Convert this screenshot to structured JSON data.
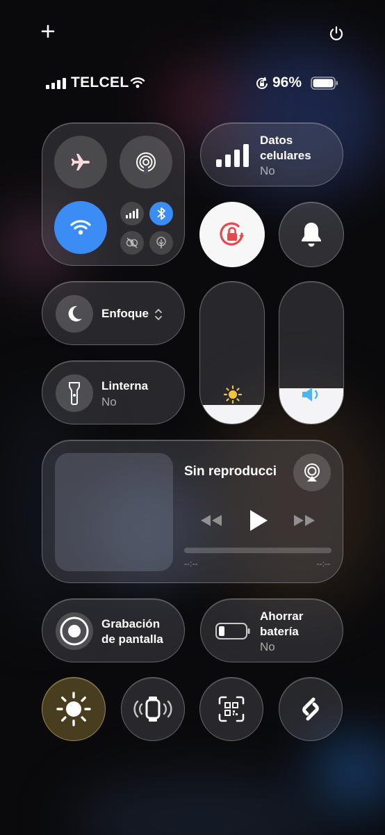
{
  "status_bar": {
    "carrier": "TELCEL",
    "battery_percent": "96%",
    "battery_level": 0.96,
    "icons": [
      "plus-icon",
      "power-icon",
      "cellular-signal-icon",
      "wifi-icon",
      "orientation-lock-icon",
      "battery-icon"
    ]
  },
  "connectivity": {
    "airplane_mode": {
      "icon": "airplane-icon",
      "active": false
    },
    "airdrop": {
      "icon": "airdrop-icon",
      "active": false
    },
    "wifi": {
      "icon": "wifi-icon",
      "active": true
    },
    "cellular": {
      "icon": "cellular-signal-icon"
    },
    "bluetooth": {
      "icon": "bluetooth-icon",
      "active": true
    },
    "personal_hotspot": {
      "icon": "link-off-icon"
    },
    "vpn": {
      "icon": "tree-icon"
    }
  },
  "cellular_data": {
    "title": "Datos celulares",
    "status": "No"
  },
  "orientation_lock": {
    "icon": "orientation-lock-icon",
    "active": true
  },
  "silent_mode": {
    "icon": "bell-icon"
  },
  "focus": {
    "label": "Enfoque"
  },
  "flashlight": {
    "title": "Linterna",
    "status": "No"
  },
  "brightness": {
    "icon": "sun-icon",
    "level": 0.13
  },
  "volume": {
    "icon": "speaker-icon",
    "level": 0.25
  },
  "media": {
    "title": "Sin reproducci",
    "elapsed": "--:--",
    "remaining": "--:--"
  },
  "screen_recording": {
    "title_line1": "Grabación",
    "title_line2": "de pantalla"
  },
  "low_power": {
    "title_line1": "Ahorrar",
    "title_line2": "batería",
    "status": "No"
  },
  "bottom_row": [
    {
      "icon": "brightness-icon"
    },
    {
      "icon": "watch-ping-icon"
    },
    {
      "icon": "qr-scanner-icon"
    },
    {
      "icon": "shazam-icon"
    }
  ],
  "colors": {
    "accent_blue": "#3c8cf6",
    "lock_red": "#e5484d",
    "sun_yellow": "#f5c542",
    "volume_blue": "#4fb4ec"
  }
}
